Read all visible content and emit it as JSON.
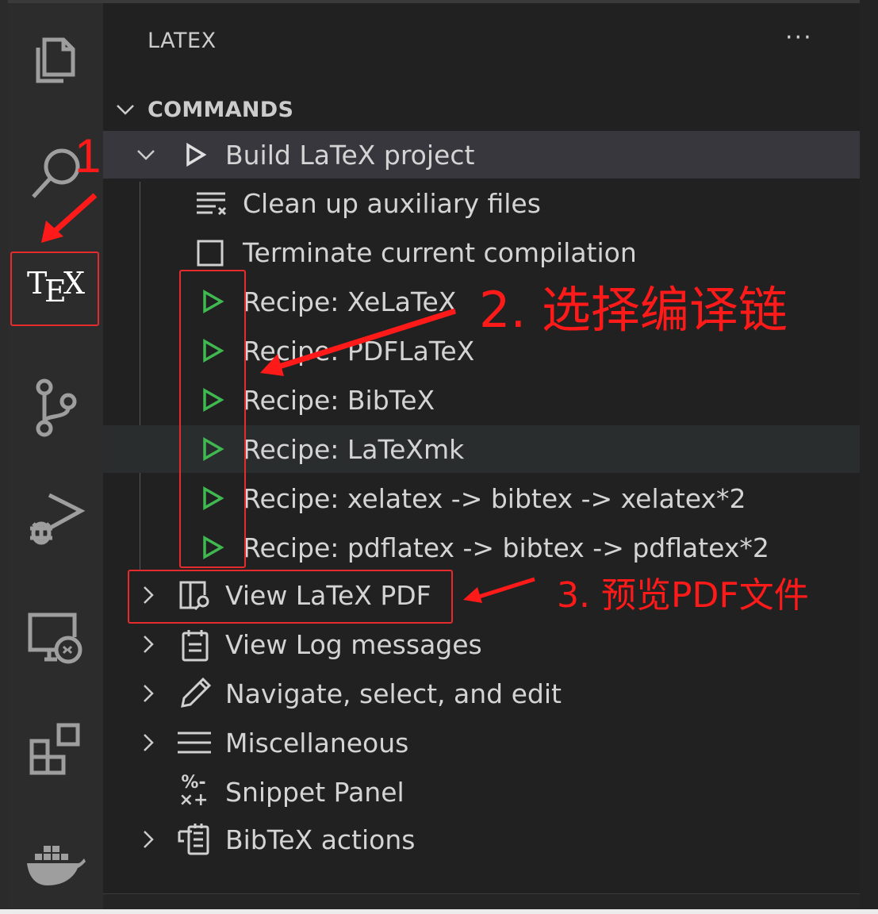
{
  "colors": {
    "activity_bg": "#2c2c2c",
    "sidebar_bg": "#212121",
    "selected_row": "#37373d",
    "text": "#d4d4d4",
    "play_green": "#3fb950",
    "annotation_red": "#ff1a1a"
  },
  "activity_bar": {
    "items": [
      {
        "name": "explorer",
        "icon": "files-icon"
      },
      {
        "name": "search",
        "icon": "search-icon"
      },
      {
        "name": "latex",
        "icon": "tex-icon",
        "label": "TEX",
        "active": true
      },
      {
        "name": "source-control",
        "icon": "source-control-icon"
      },
      {
        "name": "run-debug",
        "icon": "debug-icon"
      },
      {
        "name": "remote-explorer",
        "icon": "remote-icon"
      },
      {
        "name": "extensions",
        "icon": "extensions-icon"
      },
      {
        "name": "docker",
        "icon": "docker-icon"
      }
    ]
  },
  "sidebar": {
    "title": "LATEX",
    "more": "···",
    "section": "COMMANDS",
    "build": {
      "label": "Build LaTeX project",
      "icon": "play-icon"
    },
    "build_children": [
      {
        "label": "Clean up auxiliary files",
        "icon": "clear-all-icon"
      },
      {
        "label": "Terminate current compilation",
        "icon": "stop-square-icon"
      },
      {
        "label": "Recipe: XeLaTeX",
        "icon": "play-green-icon"
      },
      {
        "label": "Recipe: PDFLaTeX",
        "icon": "play-green-icon"
      },
      {
        "label": "Recipe: BibTeX",
        "icon": "play-green-icon"
      },
      {
        "label": "Recipe: LaTeXmk",
        "icon": "play-green-icon"
      },
      {
        "label": "Recipe: xelatex -> bibtex -> xelatex*2",
        "icon": "play-green-icon"
      },
      {
        "label": "Recipe: pdflatex -> bibtex -> pdflatex*2",
        "icon": "play-green-icon"
      }
    ],
    "groups": [
      {
        "label": "View LaTeX PDF",
        "icon": "open-preview-icon"
      },
      {
        "label": "View Log messages",
        "icon": "log-icon"
      },
      {
        "label": "Navigate, select, and edit",
        "icon": "edit-icon"
      },
      {
        "label": "Miscellaneous",
        "icon": "menu-lines-icon"
      },
      {
        "label": "Snippet Panel",
        "icon": "symbol-operator-icon"
      },
      {
        "label": "BibTeX actions",
        "icon": "bibtex-icon"
      }
    ],
    "snippet_glyph_top": "%-",
    "snippet_glyph_bottom": "×+"
  },
  "annotations": {
    "step1": "1",
    "step2": "2. 选择编译链",
    "step3": "3. 预览PDF文件"
  }
}
